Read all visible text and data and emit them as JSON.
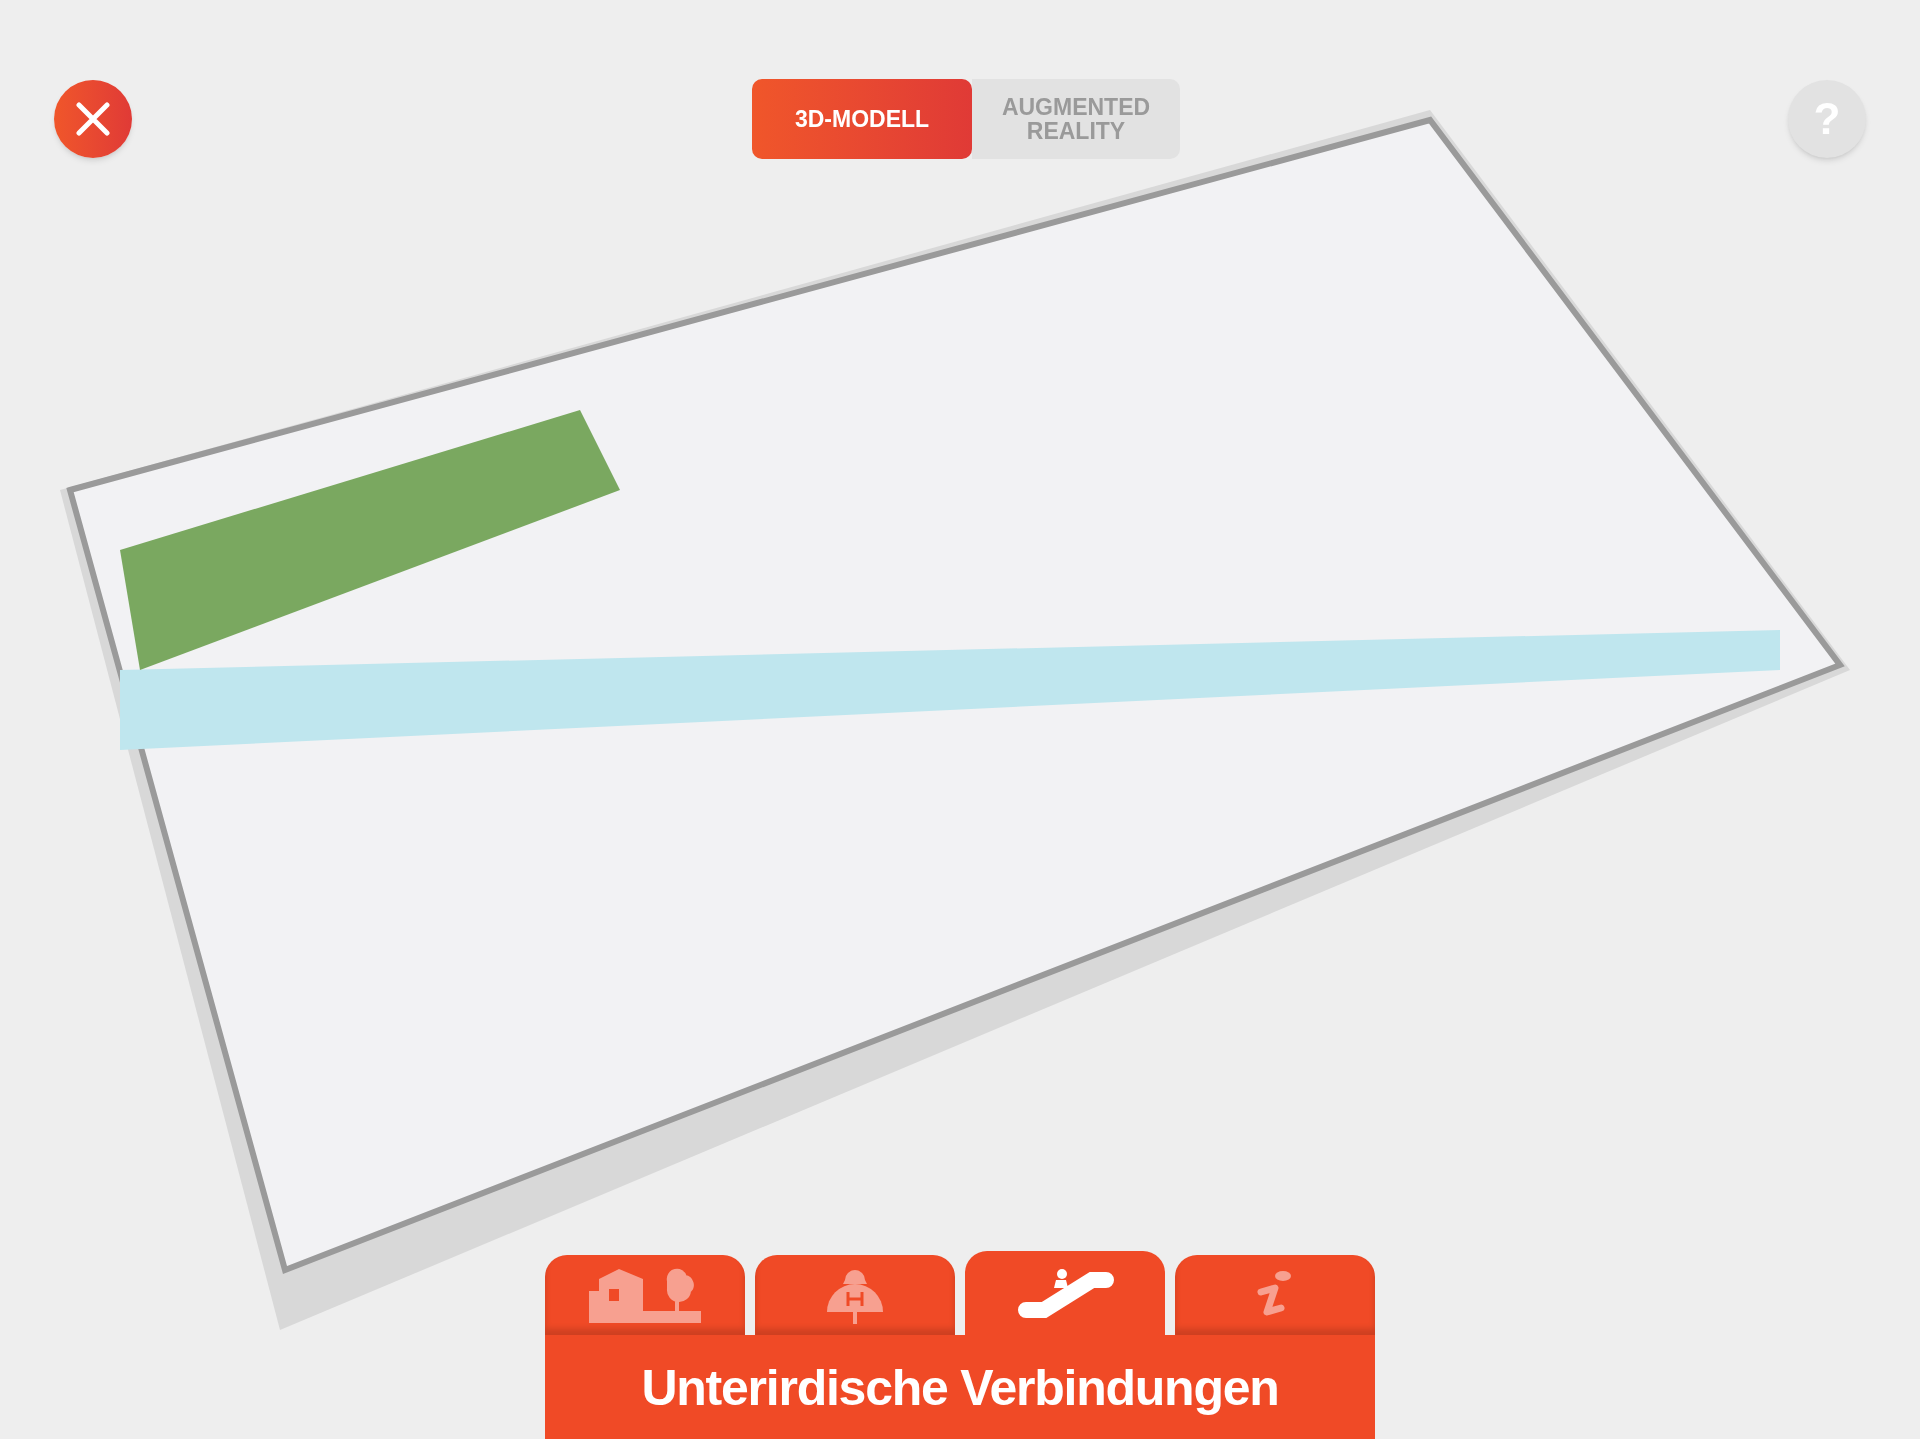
{
  "mode_switch": [
    {
      "label": "3D-MODELL",
      "selected": true
    },
    {
      "label": "AUGMENTED REALITY",
      "selected": false
    }
  ],
  "help_button": {
    "label": "?"
  },
  "tabs": [
    {
      "kind": "house",
      "selected": false
    },
    {
      "kind": "hospital",
      "selected": false
    },
    {
      "kind": "escalator",
      "selected": true
    },
    {
      "kind": "info",
      "selected": false
    }
  ],
  "panel_title": "Unterirdische Verbindungen"
}
